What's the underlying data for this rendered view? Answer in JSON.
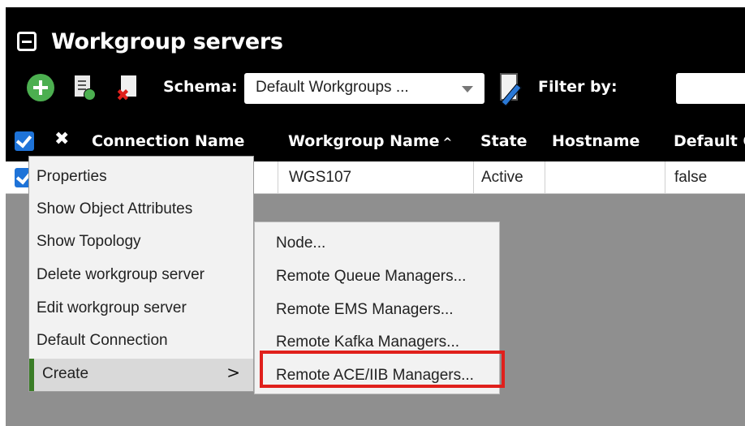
{
  "window": {
    "title": "Workgroup servers"
  },
  "toolbar": {
    "schema_label": "Schema:",
    "schema_value": "Default Workgroups ...",
    "filter_label": "Filter by:",
    "filter_value": ""
  },
  "grid": {
    "columns": [
      "Connection Name",
      "Workgroup Name",
      "State",
      "Hostname",
      "Default C"
    ],
    "sort_indicator": "^",
    "rows": [
      {
        "connection_name": "",
        "workgroup_name": "WGS107",
        "state": "Active",
        "hostname": "",
        "default_connection": "false"
      }
    ]
  },
  "context_menu": {
    "items": [
      {
        "label": "Properties"
      },
      {
        "label": "Show Object Attributes"
      },
      {
        "label": "Show Topology"
      },
      {
        "label": "Delete workgroup server"
      },
      {
        "label": "Edit workgroup server"
      },
      {
        "label": "Default Connection"
      },
      {
        "label": "Create",
        "has_submenu": true,
        "submenu_arrow": ">"
      }
    ]
  },
  "submenu": {
    "items": [
      {
        "label": "Node..."
      },
      {
        "label": "Remote Queue Managers..."
      },
      {
        "label": "Remote EMS Managers..."
      },
      {
        "label": "Remote Kafka Managers..."
      },
      {
        "label": "Remote ACE/IIB Managers..."
      }
    ],
    "highlight_color": "#e0201c"
  },
  "colors": {
    "header_bg": "#000000",
    "panel_bg": "#8f8f8f",
    "accent_blue": "#1e73d8",
    "add_green": "#4caf50",
    "menu_active_bar": "#3a7d27"
  }
}
